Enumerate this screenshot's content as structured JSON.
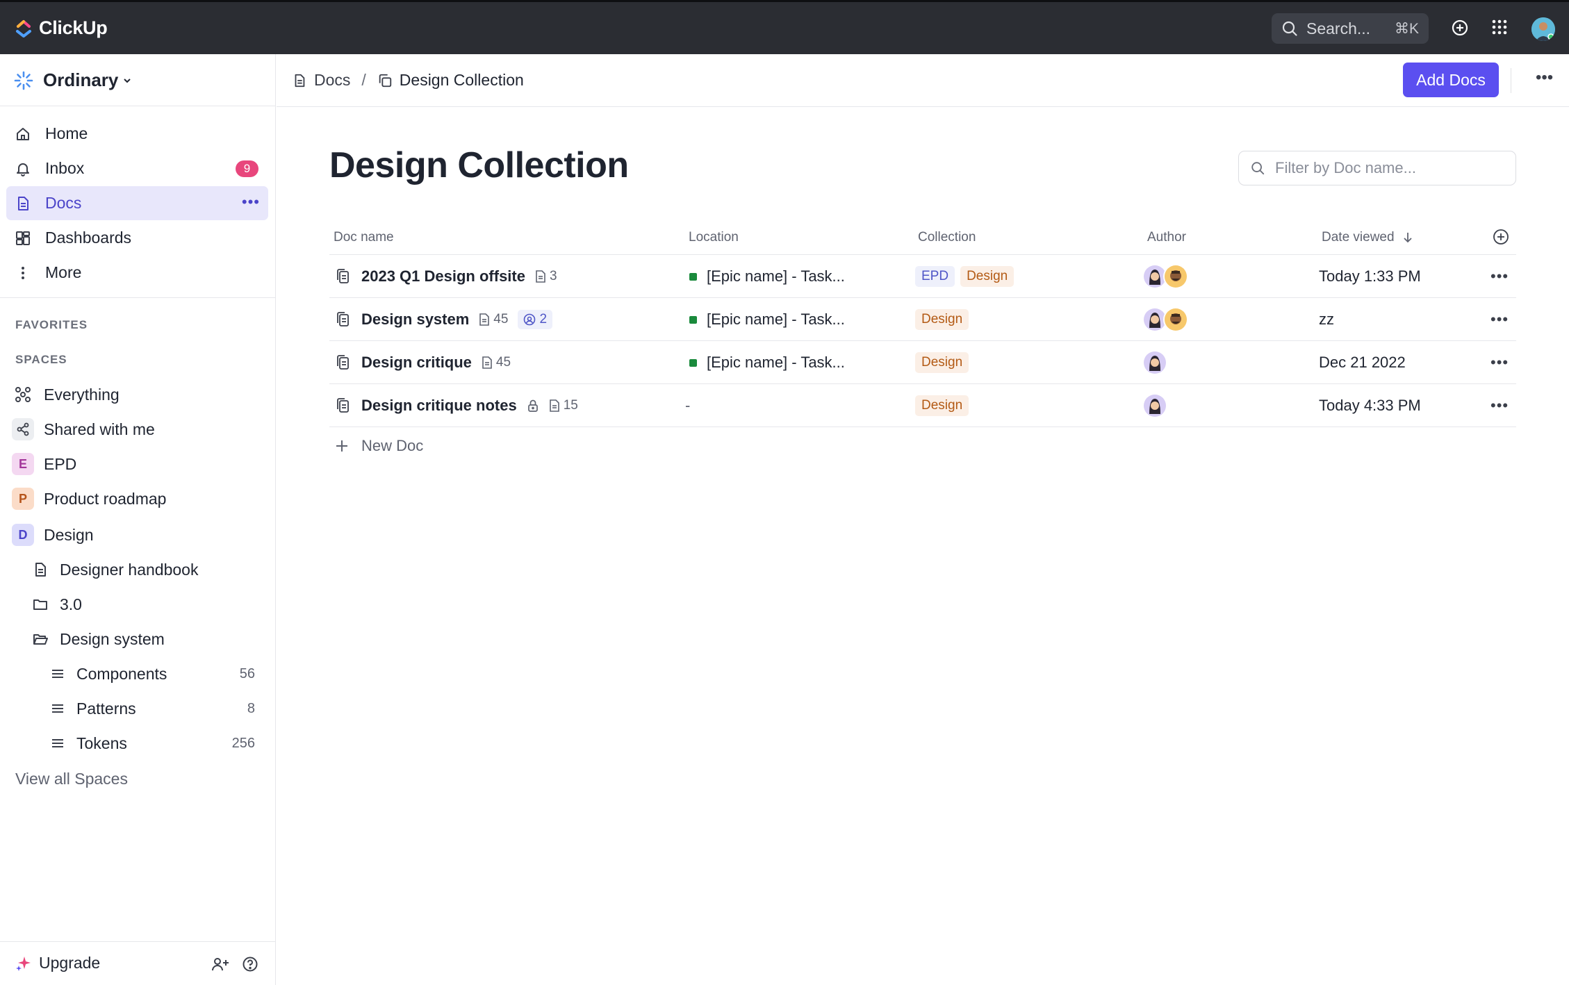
{
  "app": {
    "name": "ClickUp"
  },
  "topbar": {
    "search_placeholder": "Search...",
    "search_shortcut": "⌘K"
  },
  "sidebar": {
    "workspace": "Ordinary",
    "nav": [
      {
        "label": "Home",
        "icon": "home-icon"
      },
      {
        "label": "Inbox",
        "icon": "bell-icon",
        "badge": "9"
      },
      {
        "label": "Docs",
        "icon": "doc-icon",
        "active": true
      },
      {
        "label": "Dashboards",
        "icon": "dashboard-icon"
      },
      {
        "label": "More",
        "icon": "more-vertical-icon"
      }
    ],
    "favorites_label": "FAVORITES",
    "spaces_label": "SPACES",
    "spaces": [
      {
        "label": "Everything",
        "icon": "everything-icon"
      },
      {
        "label": "Shared with me",
        "icon": "share-icon"
      },
      {
        "label": "EPD",
        "letter": "E",
        "color": "#f4d8f1",
        "text_color": "#a3379a"
      },
      {
        "label": "Product roadmap",
        "letter": "P",
        "color": "#fbdcc8",
        "text_color": "#b5541a"
      },
      {
        "label": "Design",
        "letter": "D",
        "color": "#dcdcfb",
        "text_color": "#4b44c9"
      }
    ],
    "design_children": [
      {
        "label": "Designer handbook",
        "icon": "doc-icon"
      },
      {
        "label": "3.0",
        "icon": "folder-icon"
      },
      {
        "label": "Design system",
        "icon": "folder-open-icon"
      }
    ],
    "lists": [
      {
        "label": "Components",
        "count": "56"
      },
      {
        "label": "Patterns",
        "count": "8"
      },
      {
        "label": "Tokens",
        "count": "256"
      }
    ],
    "view_all": "View all Spaces",
    "upgrade": "Upgrade"
  },
  "header": {
    "breadcrumb": [
      "Docs",
      "Design Collection"
    ],
    "separator": "/",
    "add_button": "Add Docs"
  },
  "main": {
    "title": "Design Collection",
    "filter_placeholder": "Filter by Doc name...",
    "columns": [
      "Doc name",
      "Location",
      "Collection",
      "Author",
      "Date viewed"
    ],
    "rows": [
      {
        "name": "2023 Q1 Design offsite",
        "pages": "3",
        "location": "[Epic name] - Task...",
        "collections": [
          "EPD",
          "Design"
        ],
        "authors": 2,
        "date": "Today 1:33 PM"
      },
      {
        "name": "Design system",
        "pages": "45",
        "shared": "2",
        "location": "[Epic name] - Task...",
        "collections": [
          "Design"
        ],
        "authors": 2,
        "date": "zz"
      },
      {
        "name": "Design critique",
        "pages": "45",
        "location": "[Epic name] - Task...",
        "collections": [
          "Design"
        ],
        "authors": 1,
        "date": "Dec 21 2022"
      },
      {
        "name": "Design critique notes",
        "pages": "15",
        "locked": true,
        "location": "-",
        "collections": [
          "Design"
        ],
        "authors": 1,
        "date": "Today 4:33 PM"
      }
    ],
    "new_doc": "New Doc"
  },
  "colors": {
    "accent": "#5b4ff0",
    "topbar": "#2b2d33",
    "active_bg": "#e8e7fb",
    "badge": "#e8467c"
  }
}
